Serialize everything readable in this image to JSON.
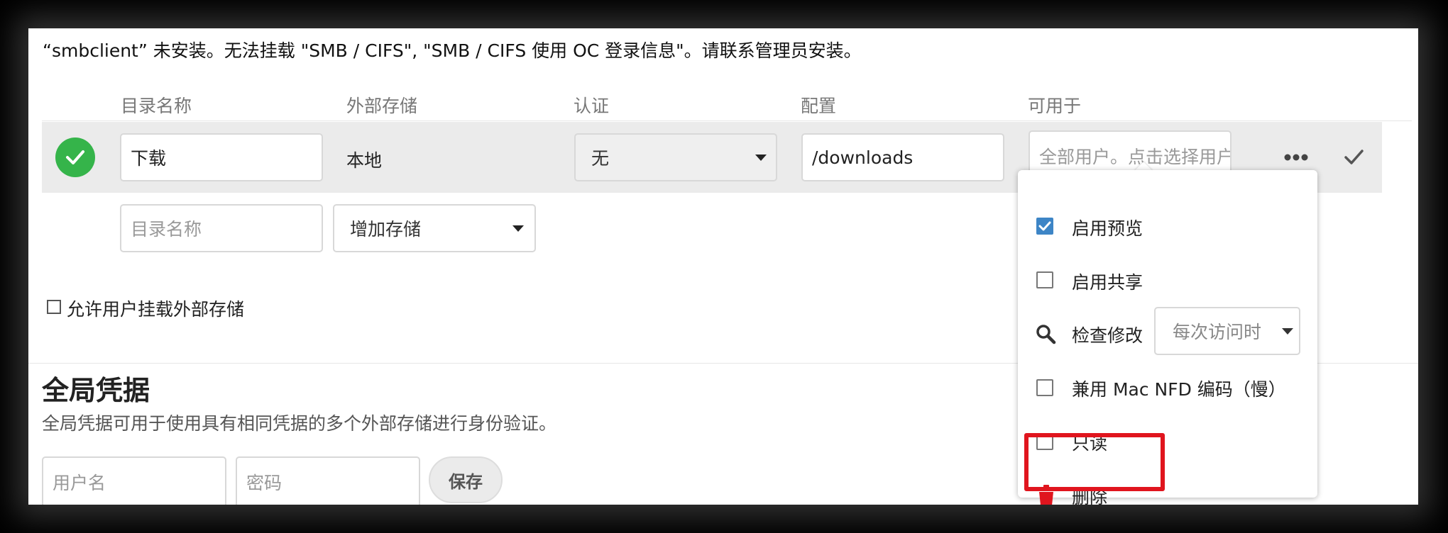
{
  "warning_text": "“smbclient” 未安装。无法挂载 \"SMB / CIFS\", \"SMB / CIFS 使用 OC 登录信息\"。请联系管理员安装。",
  "columns": {
    "folder_name": "目录名称",
    "external_storage": "外部存储",
    "authentication": "认证",
    "configuration": "配置",
    "available_for": "可用于"
  },
  "mount_row": {
    "folder_name_value": "下载",
    "storage_type": "本地",
    "auth_selected": "无",
    "config_value": "/downloads",
    "available_for_placeholder": "全部用户。点击选择用户和组"
  },
  "new_row": {
    "folder_name_placeholder": "目录名称",
    "add_storage_label": "增加存储"
  },
  "allow_user_mount_label": "允许用户挂载外部存储",
  "global_credentials": {
    "title": "全局凭据",
    "description": "全局凭据可用于使用具有相同凭据的多个外部存储进行身份验证。",
    "username_placeholder": "用户名",
    "password_placeholder": "密码",
    "save_label": "保存"
  },
  "options_menu": {
    "enable_preview": {
      "label": "启用预览",
      "checked": true
    },
    "enable_sharing": {
      "label": "启用共享",
      "checked": false
    },
    "check_changes": {
      "label": "检查修改",
      "selected": "每次访问时"
    },
    "mac_nfd": {
      "label": "兼用 Mac NFD 编码（慢）",
      "checked": false
    },
    "read_only": {
      "label": "只读",
      "checked": false
    },
    "delete_label": "删除"
  },
  "colors": {
    "status_ok": "#35b44a",
    "checkbox_checked": "#3d85c6",
    "delete_red": "#e0151e",
    "row_highlight": "#ebebeb"
  }
}
